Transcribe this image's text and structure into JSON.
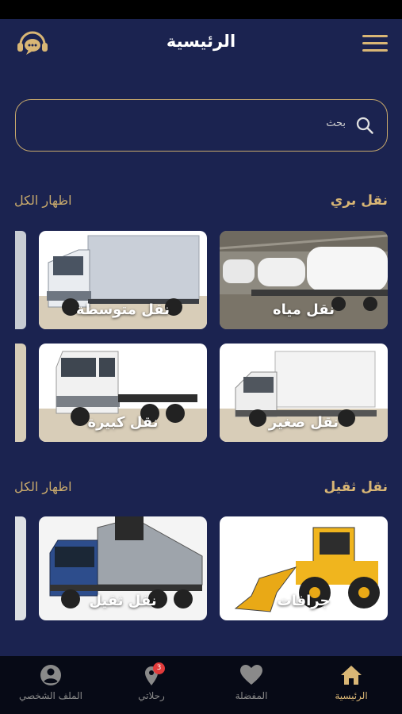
{
  "header": {
    "title": "الرئيسية"
  },
  "search": {
    "placeholder": "بحث"
  },
  "sections": [
    {
      "title": "نقل بري",
      "show_all": "اظهار الكل",
      "cards": [
        "نقل مياه",
        "نقل متوسطة",
        "نقل صغير",
        "نقل كبيرة"
      ]
    },
    {
      "title": "نقل ثقيل",
      "show_all": "اظهار الكل",
      "cards": [
        "جرافات",
        "نقل ثقيل"
      ]
    }
  ],
  "tabbar": {
    "items": [
      {
        "label": "الرئيسية",
        "icon": "home-icon",
        "active": true
      },
      {
        "label": "المفضلة",
        "icon": "heart-icon",
        "active": false
      },
      {
        "label": "رحلاتي",
        "icon": "location-pin-icon",
        "active": false,
        "badge": "3"
      },
      {
        "label": "الملف الشخصي",
        "icon": "user-icon",
        "active": false
      }
    ]
  },
  "colors": {
    "background": "#1b2350",
    "accent": "#d9b675",
    "tabbar": "#070a16",
    "badge": "#e23b3b"
  }
}
